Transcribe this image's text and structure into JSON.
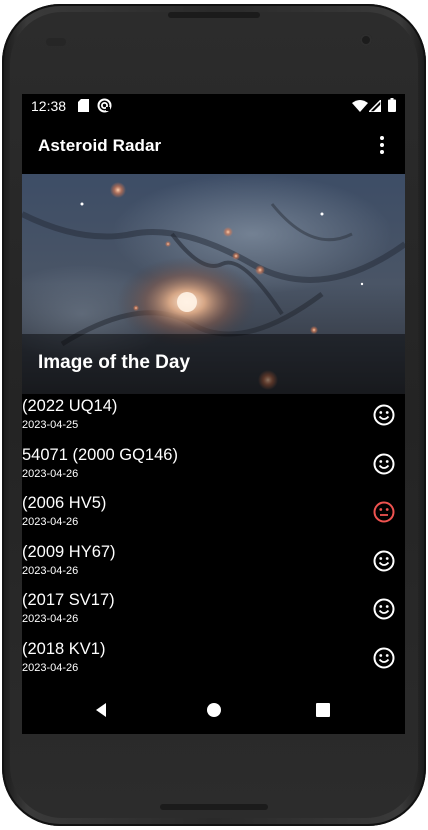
{
  "status_bar": {
    "time": "12:38",
    "icons": [
      "sd-card-icon",
      "sync-icon",
      "wifi-icon",
      "signal-icon",
      "battery-icon"
    ]
  },
  "app_bar": {
    "title": "Asteroid Radar",
    "menu_icon": "more-vert-icon"
  },
  "image_of_day": {
    "caption": "Image of the Day"
  },
  "asteroids": [
    {
      "name": "(2022 UQ14)",
      "date": "2023-04-25",
      "hazardous": false
    },
    {
      "name": "54071 (2000 GQ146)",
      "date": "2023-04-26",
      "hazardous": false
    },
    {
      "name": "(2006 HV5)",
      "date": "2023-04-26",
      "hazardous": true
    },
    {
      "name": "(2009 HY67)",
      "date": "2023-04-26",
      "hazardous": false
    },
    {
      "name": "(2017 SV17)",
      "date": "2023-04-26",
      "hazardous": false
    },
    {
      "name": "(2018 KV1)",
      "date": "2023-04-26",
      "hazardous": false
    }
  ],
  "colors": {
    "safe": "#ffffff",
    "hazardous": "#ef5350",
    "background": "#000000"
  },
  "nav_bar": {
    "icons": [
      "back-icon",
      "home-icon",
      "recents-icon"
    ]
  }
}
